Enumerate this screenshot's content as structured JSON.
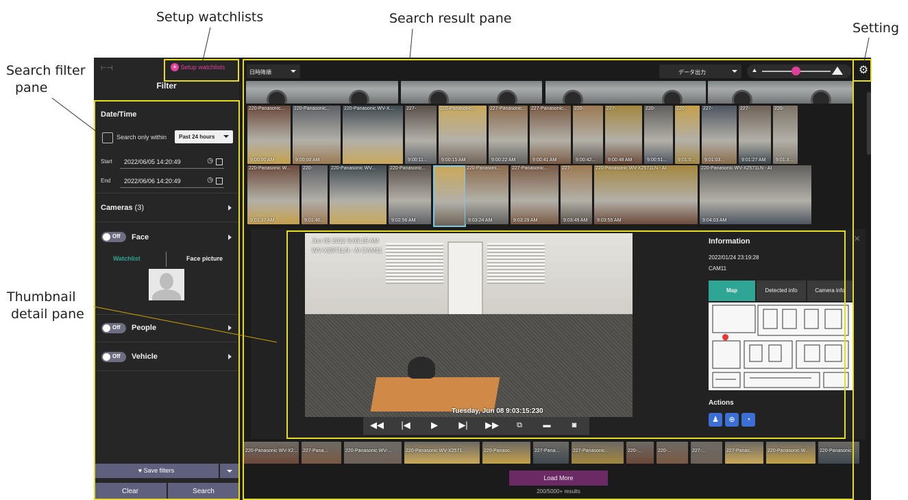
{
  "annotations": {
    "setup_watchlists": "Setup watchlists",
    "search_result_pane": "Search result pane",
    "setting": "Setting",
    "search_filter_pane": [
      "Search filter",
      "pane"
    ],
    "thumbnail_detail_pane": [
      "Thumbnail",
      "detail pane"
    ]
  },
  "sidebar": {
    "collapse_icon": "⊢⊣",
    "setup_watchlists": "Setup watchlists",
    "title": "Filter",
    "datetime": {
      "title": "Date/Time",
      "search_only_within": "Search only within",
      "range_select": "Past 24 hours",
      "start_label": "Start",
      "start_value": "2022/06/05  14:20:49",
      "end_label": "End",
      "end_value": "2022/06/06  14:20:49"
    },
    "cameras": {
      "title": "Cameras",
      "count": "(3)"
    },
    "face": {
      "toggle": "Off",
      "title": "Face",
      "watchlist_tab": "Watchlist",
      "face_picture_tab": "Face picture"
    },
    "people": {
      "toggle": "Off",
      "title": "People"
    },
    "vehicle": {
      "toggle": "Off",
      "title": "Vehicle"
    },
    "save_filters": "Save filters",
    "clear": "Clear",
    "search": "Search"
  },
  "results": {
    "sort_select": "日時降順",
    "export_select": "データ出力",
    "zoom_slider_level": 0.5,
    "row1": [
      {
        "cap": "220-Panasonic...",
        "time": "9:00:00 AM"
      },
      {
        "cap": "220-Panasonic...",
        "time": "9:00:00 AM"
      },
      {
        "cap": "220-Panasonic WV-X...",
        "time": ""
      },
      {
        "cap": "227-",
        "time": "9:00:11..."
      },
      {
        "cap": "220-Panasonic...",
        "time": "9:00:15 AM"
      },
      {
        "cap": "227-Panasonic...",
        "time": "9:00:22 AM"
      },
      {
        "cap": "227-Panasonic...",
        "time": "9:00:41 AM"
      },
      {
        "cap": "220-",
        "time": "9:00:42..."
      },
      {
        "cap": "227-",
        "time": "9:00:48 AM"
      },
      {
        "cap": "220-",
        "time": "9:00:51..."
      },
      {
        "cap": "220-",
        "time": "9:01:0..."
      },
      {
        "cap": "227-",
        "time": "9:01:03..."
      },
      {
        "cap": "227-",
        "time": "9:01:27 AM"
      },
      {
        "cap": "220-",
        "time": "9:01:3..."
      }
    ],
    "row2": [
      {
        "cap": "220-Panasonic W...",
        "time": "9:01:37 AM"
      },
      {
        "cap": "220-",
        "time": "9:01:40..."
      },
      {
        "cap": "220-Panasonic WV...",
        "time": ""
      },
      {
        "cap": "220-Panasonic...",
        "time": "9:02:56 AM"
      },
      {
        "cap": "",
        "time": ""
      },
      {
        "cap": "220-Panasoni...",
        "time": "9:03:24 AM"
      },
      {
        "cap": "227-Panasonic...",
        "time": "9:03:29 AM"
      },
      {
        "cap": "227-",
        "time": "9:03:49 AM"
      },
      {
        "cap": "220-Panasonic WV-X2571LN - AI",
        "time": "9:03:55 AM"
      },
      {
        "cap": "220-Panasonic WV-X2571LN - AI",
        "time": "9:04:03 AM"
      }
    ],
    "bottom_strip": [
      "220-Panasonic WV-X2...",
      "227-Pana...",
      "220-Panasonic WV-...",
      "220-Panasonic WV-X2571...",
      "220-Panaso...",
      "227-Pana...",
      "227-Panasonic...",
      "220-...",
      "220-...",
      "227-...",
      "227-Panas...",
      "220-Panasonic W...",
      "220-Panasonic"
    ],
    "load_more": "Load More",
    "results_count": "200/5000+ results"
  },
  "detail": {
    "video_overlay_top1": "Jun 08 2022 9:03:15 AM",
    "video_overlay_top2": "WV-X2571LN - AI CAM11",
    "video_timestamp": "Tuesday, Jun 08  9:03:15:230",
    "info_title": "Information",
    "info_datetime": "2022/01/24 23:19:28",
    "info_camera": "CAM11",
    "tabs": [
      "Map",
      "Detected info",
      "Camera info"
    ],
    "actions_title": "Actions",
    "close": "×"
  },
  "colors": {
    "accent_pink": "#e0409a",
    "teal": "#2fa595",
    "highlight": "#e6dc21",
    "load_more": "#6b2a63",
    "action_blue": "#3b6fd6"
  }
}
